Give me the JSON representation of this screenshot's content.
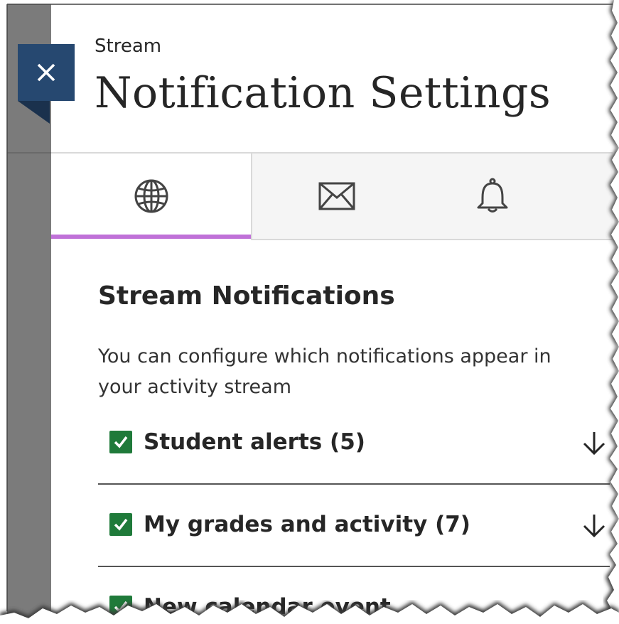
{
  "panel": {
    "eyebrow": "Stream",
    "title": "Notification Settings"
  },
  "tabs": [
    {
      "name": "Stream",
      "icon": "globe-icon",
      "active": true
    },
    {
      "name": "Email",
      "icon": "envelope-icon",
      "active": false
    },
    {
      "name": "Push",
      "icon": "bell-icon",
      "active": false
    }
  ],
  "section": {
    "title": "Stream Notifications",
    "description": "You can configure which notifications appear in your activity stream"
  },
  "notifications": [
    {
      "label": "Student alerts (5)",
      "checked": true
    },
    {
      "label": "My grades and activity (7)",
      "checked": true
    },
    {
      "label": "New calendar event",
      "checked": true
    }
  ],
  "colors": {
    "close_button": "#264870",
    "tab_active_underline": "#c071d8",
    "checkbox": "#1f7a3a",
    "rail": "#7b7b7b"
  }
}
